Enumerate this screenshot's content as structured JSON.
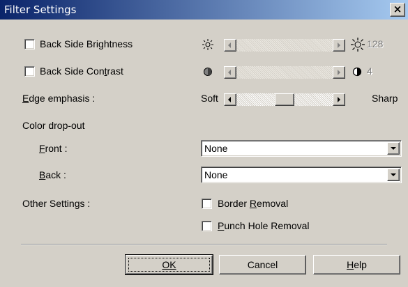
{
  "window": {
    "title": "Filter Settings",
    "close_label": "×"
  },
  "brightness": {
    "label_pre": "Back Side Bri",
    "label_key": "g",
    "label_post": "htness",
    "value": "128",
    "left_icon": "sun-small-icon",
    "right_icon": "sun-large-icon",
    "enabled": false
  },
  "contrast": {
    "label_pre": "Back Side Con",
    "label_key": "t",
    "label_post": "rast",
    "value": "4",
    "left_icon": "contrast-low-icon",
    "right_icon": "contrast-high-icon",
    "enabled": false
  },
  "edge": {
    "label_key": "E",
    "label_post": "dge emphasis :",
    "min_label": "Soft",
    "max_label": "Sharp",
    "level": 0.5
  },
  "color_dropout": {
    "heading": "Color drop-out",
    "front": {
      "label_key": "F",
      "label_post": "ront :",
      "value": "None"
    },
    "back": {
      "label_key": "B",
      "label_post": "ack :",
      "value": "None"
    }
  },
  "other": {
    "heading": "Other Settings :",
    "border_removal": {
      "label_pre": "Border ",
      "label_key": "R",
      "label_post": "emoval",
      "checked": false
    },
    "punch_hole": {
      "label_key": "P",
      "label_post": "unch Hole Removal",
      "checked": false
    }
  },
  "buttons": {
    "ok": "OK",
    "cancel": "Cancel",
    "help_key": "H",
    "help_post": "elp"
  }
}
